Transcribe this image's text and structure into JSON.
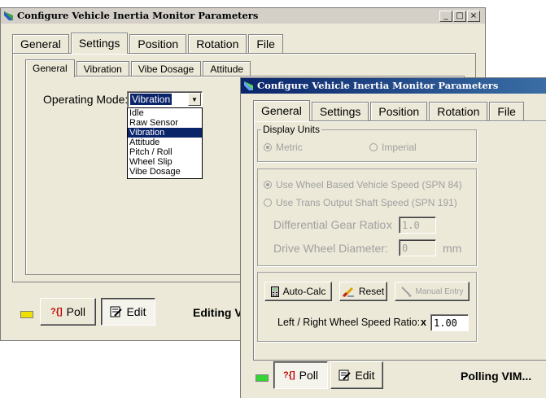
{
  "back_window": {
    "title": "Configure Vehicle Inertia Monitor Parameters",
    "caption_buttons": [
      "_",
      "□",
      "×"
    ],
    "tabs": [
      "General",
      "Settings",
      "Position",
      "Rotation",
      "File"
    ],
    "active_tab": "Settings",
    "subtabs": [
      "General",
      "Vibration",
      "Vibe Dosage",
      "Attitude"
    ],
    "active_subtab": "General",
    "operating_mode_label": "Operating Mode:",
    "operating_mode_value": "Vibration",
    "mode_options": [
      "Idle",
      "Raw Sensor",
      "Vibration",
      "Attitude",
      "Pitch / Roll",
      "Wheel Slip",
      "Vibe Dosage"
    ],
    "highlighted_option": "Vibration",
    "poll_button": "Poll",
    "edit_button": "Edit",
    "status_text": "Editing V",
    "led_color": "#f0e000"
  },
  "front_window": {
    "title": "Configure Vehicle Inertia Monitor Parameters",
    "tabs": [
      "General",
      "Settings",
      "Position",
      "Rotation",
      "File"
    ],
    "active_tab": "General",
    "display_units": {
      "title": "Display Units",
      "metric": "Metric",
      "imperial": "Imperial",
      "selected": "Metric"
    },
    "speed_source": {
      "option1": "Use Wheel Based Vehicle Speed (SPN 84)",
      "option2": "Use Trans Output Shaft Speed (SPN 191)",
      "selected": "option1"
    },
    "gear_ratio_label": "Differential Gear Ratio:",
    "gear_ratio_prefix": "x",
    "gear_ratio_value": "1.0",
    "wheel_diameter_label": "Drive Wheel Diameter:",
    "wheel_diameter_value": "0",
    "wheel_diameter_unit": "mm",
    "autocalc_button": "Auto-Calc",
    "reset_button": "Reset",
    "manual_entry_button": "Manual Entry",
    "lr_ratio_label": "Left / Right Wheel Speed Ratio:",
    "lr_ratio_prefix": "x",
    "lr_ratio_value": "1.00",
    "poll_button": "Poll",
    "edit_button": "Edit",
    "status_text": "Polling VIM...",
    "led_color": "#33d633"
  },
  "icons": {
    "app": "app-icon",
    "poll": "poll-icon",
    "edit": "edit-icon",
    "calculator": "calculator-icon",
    "reset": "eraser-icon",
    "manual": "manual-entry-icon"
  }
}
